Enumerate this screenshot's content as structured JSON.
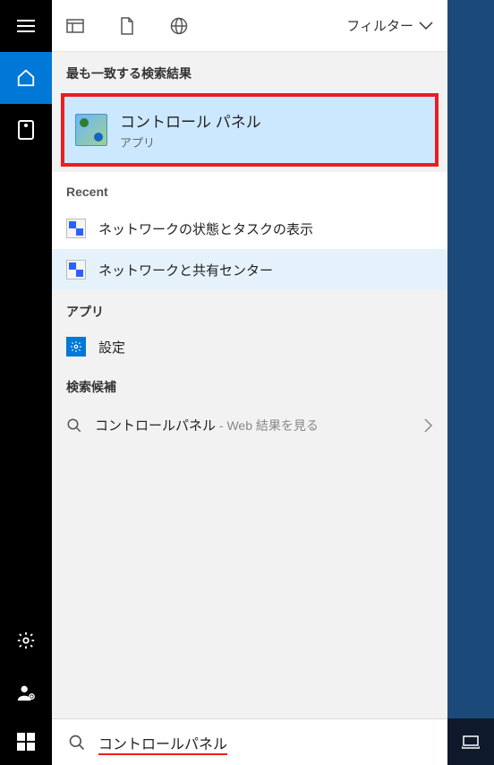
{
  "header": {
    "filter_label": "フィルター"
  },
  "sections": {
    "best_match_title": "最も一致する検索結果",
    "recent_title": "Recent",
    "apps_title": "アプリ",
    "suggest_title": "検索候補"
  },
  "best_match": {
    "title": "コントロール パネル",
    "subtitle": "アプリ"
  },
  "recent": {
    "items": [
      {
        "label": "ネットワークの状態とタスクの表示"
      },
      {
        "label": "ネットワークと共有センター"
      }
    ]
  },
  "apps": {
    "items": [
      {
        "label": "設定"
      }
    ]
  },
  "suggest": {
    "items": [
      {
        "main": "コントロールパネル",
        "hint": " - Web 結果を見る"
      }
    ]
  },
  "search": {
    "value": "コントロールパネル"
  }
}
